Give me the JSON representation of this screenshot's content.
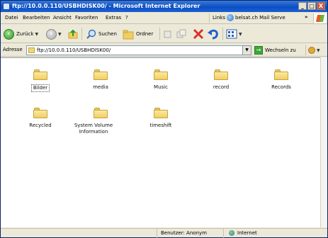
{
  "window": {
    "title": "ftp://10.0.0.110/USBHDISK00/ - Microsoft Internet Explorer",
    "buttons": {
      "minimize": "_",
      "maximize": "□",
      "close": "X"
    }
  },
  "menu": {
    "items": [
      "Datei",
      "Bearbeiten",
      "Ansicht",
      "Favoriten",
      "Extras",
      "?"
    ],
    "links_label": "Links",
    "links_item": "belsat.ch Mail Serve",
    "links_more": "»"
  },
  "toolbar": {
    "back_label": "Zurück",
    "search_label": "Suchen",
    "folders_label": "Ordner"
  },
  "address": {
    "label": "Adresse",
    "value": "ftp://10.0.0.110/USBHDISK00/",
    "go_label": "Wechseln zu"
  },
  "folders": [
    {
      "name": "Bilder"
    },
    {
      "name": "media"
    },
    {
      "name": "Music"
    },
    {
      "name": "record"
    },
    {
      "name": "Records"
    },
    {
      "name": "Recycled"
    },
    {
      "name": "System Volume Information"
    },
    {
      "name": "timeshift"
    }
  ],
  "status": {
    "user": "Benutzer: Anonym",
    "zone": "Internet"
  },
  "colors": {
    "titlebar": "#0a4fc6",
    "chrome": "#ece9d8",
    "folder": "#f0cf62"
  }
}
